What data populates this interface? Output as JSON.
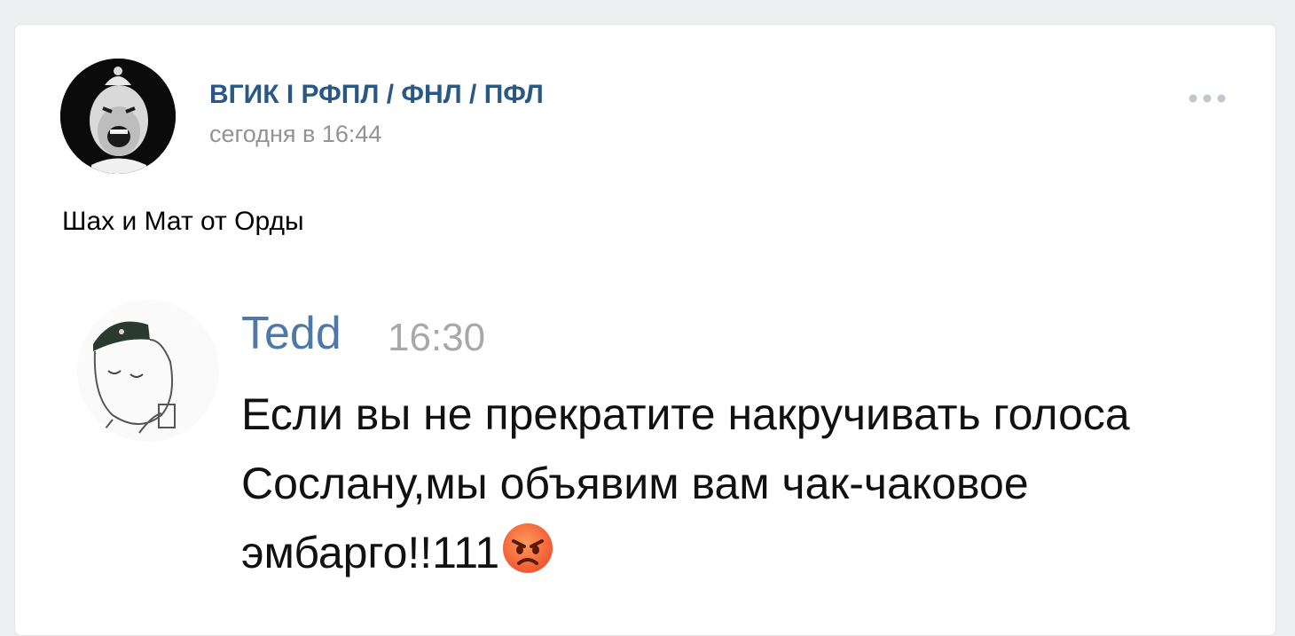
{
  "post": {
    "author": "ВГИК I РФПЛ / ФНЛ / ПФЛ",
    "time": "сегодня в 16:44",
    "text": "Шах и Мат от Орды",
    "more_icon": "more-dots-icon"
  },
  "message": {
    "name": "Tedd",
    "time": "16:30",
    "text": "Если вы не прекратите накручивать голоса Сослану,мы объявим вам чак-чаковое эмбарго!!111",
    "emoji": "angry-face-emoji"
  },
  "colors": {
    "link": "#2a5885",
    "name": "#4e78a6",
    "muted": "#939393",
    "background": "#edeef0",
    "card": "#ffffff"
  }
}
